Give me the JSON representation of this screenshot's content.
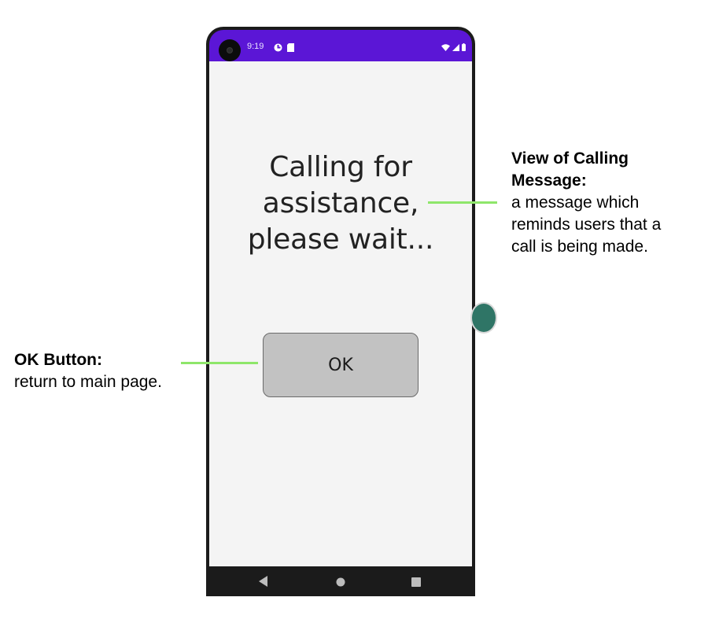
{
  "status_bar": {
    "time": "9:19",
    "color": "#5b16d6",
    "left_icons": [
      "app-notification-icon",
      "sd-card-icon"
    ],
    "right_icons": [
      "wifi-icon",
      "signal-icon",
      "battery-icon"
    ]
  },
  "screen": {
    "message_lines": [
      "Calling for",
      "assistance,",
      "please wait..."
    ],
    "ok_label": "OK"
  },
  "nav_bar": {
    "items": [
      "back-icon",
      "home-icon",
      "recents-icon"
    ]
  },
  "annotations": {
    "message": {
      "title_lines": [
        "View of Calling",
        "Message:"
      ],
      "desc_lines": [
        "a message which",
        "reminds users that a",
        "call is being made."
      ]
    },
    "ok_button": {
      "title": "OK Button:",
      "desc": "return to main page."
    },
    "leader_color": "#8ee66a"
  }
}
